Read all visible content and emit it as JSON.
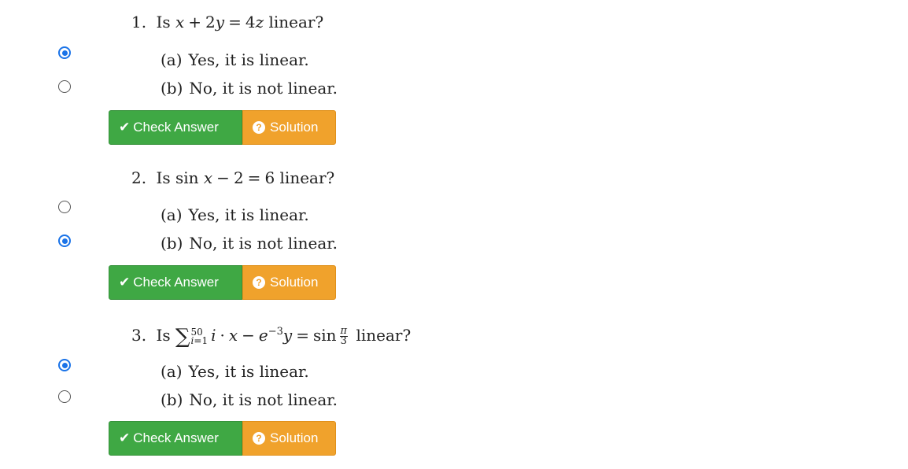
{
  "buttons": {
    "check_label": "Check Answer",
    "solution_label": "Solution"
  },
  "questions": [
    {
      "number": "1.",
      "prefix": "Is",
      "suffix": "linear?",
      "options": [
        {
          "letter": "(a)",
          "text": "Yes, it is linear.",
          "checked": true
        },
        {
          "letter": "(b)",
          "text": "No, it is not linear.",
          "checked": false
        }
      ]
    },
    {
      "number": "2.",
      "prefix": "Is",
      "suffix": "linear?",
      "options": [
        {
          "letter": "(a)",
          "text": "Yes, it is linear.",
          "checked": false
        },
        {
          "letter": "(b)",
          "text": "No, it is not linear.",
          "checked": true
        }
      ]
    },
    {
      "number": "3.",
      "prefix": "Is",
      "suffix": "linear?",
      "options": [
        {
          "letter": "(a)",
          "text": "Yes, it is linear.",
          "checked": true
        },
        {
          "letter": "(b)",
          "text": "No, it is not linear.",
          "checked": false
        }
      ]
    }
  ]
}
